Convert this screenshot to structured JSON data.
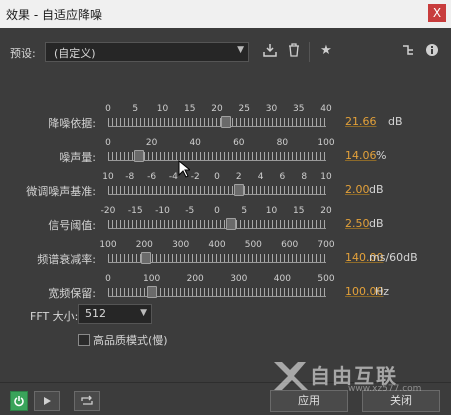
{
  "window": {
    "title": "效果 - 自适应降噪",
    "close_glyph": "X"
  },
  "preset": {
    "label": "预设:",
    "value": "(自定义)"
  },
  "toolbar_icons": [
    "download-icon",
    "trash-icon",
    "star-icon",
    "routing-icon",
    "info-icon"
  ],
  "params": [
    {
      "label": "降噪依据:",
      "ticks": [
        "0",
        "5",
        "10",
        "15",
        "20",
        "25",
        "30",
        "35",
        "40"
      ],
      "min": 0,
      "max": 40,
      "value": 21.66,
      "value_text": "21.66",
      "unit": "dB"
    },
    {
      "label": "噪声量:",
      "ticks": [
        "0",
        "20",
        "40",
        "60",
        "80",
        "100"
      ],
      "min": 0,
      "max": 100,
      "value": 14.06,
      "value_text": "14.06",
      "unit": "%"
    },
    {
      "label": "微调噪声基准:",
      "ticks": [
        "10",
        "-8",
        "-6",
        "-4",
        "-2",
        "0",
        "2",
        "4",
        "6",
        "8",
        "10"
      ],
      "min": -10,
      "max": 10,
      "value": 2.0,
      "value_text": "2.00",
      "unit": "dB"
    },
    {
      "label": "信号阈值:",
      "ticks": [
        "-20",
        "-15",
        "-10",
        "-5",
        "0",
        "5",
        "10",
        "15",
        "20"
      ],
      "min": -20,
      "max": 20,
      "value": 2.5,
      "value_text": "2.50",
      "unit": "dB"
    },
    {
      "label": "频谱衰减率:",
      "ticks": [
        "100",
        "200",
        "300",
        "400",
        "500",
        "600",
        "700"
      ],
      "min": 0,
      "max": 800,
      "value": 140.0,
      "value_text": "140.00",
      "unit": "ms/60dB"
    },
    {
      "label": "宽频保留:",
      "ticks": [
        "0",
        "100",
        "200",
        "300",
        "400",
        "500"
      ],
      "min": 0,
      "max": 500,
      "value": 100.0,
      "value_text": "100.00",
      "unit": "Hz"
    }
  ],
  "fft": {
    "label": "FFT 大小:",
    "value": "512"
  },
  "high_quality": {
    "label": "高品质模式(慢)",
    "checked": false
  },
  "buttons": {
    "apply": "应用",
    "close": "关闭"
  },
  "watermark": {
    "text": "自由互联",
    "sub": "www.xz577.com"
  }
}
